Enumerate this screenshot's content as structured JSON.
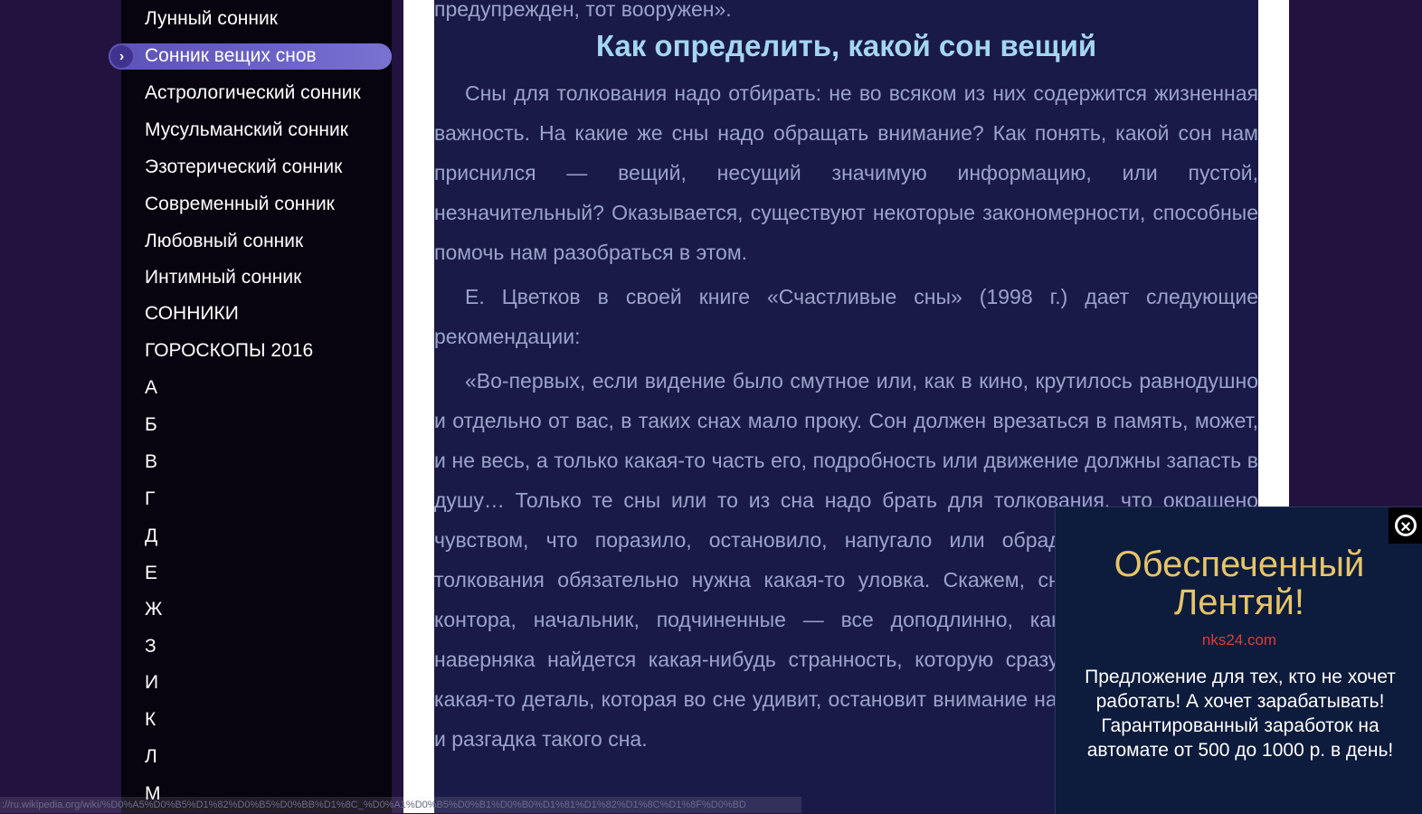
{
  "sidebar": {
    "items": [
      {
        "label": "Лунный сонник"
      },
      {
        "label": "Сонник вещих снов",
        "active": true
      },
      {
        "label": "Астрологический сонник"
      },
      {
        "label": "Мусульманский сонник"
      },
      {
        "label": "Эзотерический сонник"
      },
      {
        "label": "Современный сонник"
      },
      {
        "label": "Любовный сонник"
      },
      {
        "label": "Интимный сонник"
      },
      {
        "label": "СОННИКИ"
      },
      {
        "label": "ГОРОСКОПЫ 2016"
      },
      {
        "label": "А"
      },
      {
        "label": "Б"
      },
      {
        "label": "В"
      },
      {
        "label": "Г"
      },
      {
        "label": "Д"
      },
      {
        "label": "Е"
      },
      {
        "label": "Ж"
      },
      {
        "label": "З"
      },
      {
        "label": "И"
      },
      {
        "label": "К"
      },
      {
        "label": "Л"
      },
      {
        "label": "М"
      }
    ],
    "active_icon": "chevron-right-icon",
    "active_glyph": "›"
  },
  "article": {
    "top_fragment": "предупрежден, тот вооружен».",
    "heading": "Как определить, какой сон вещий",
    "paragraphs": [
      "Сны для толкования надо отбирать: не во всяком из них содержится жизненная важность. На какие же сны надо обращать внимание? Как понять, какой сон нам приснился — вещий, несущий значимую информацию, или пустой, незначительный? Оказывается, существуют некоторые закономерности, способные помочь нам разобраться в этом.",
      "Е. Цветков в своей книге «Счастливые сны» (1998 г.) дает следующие рекомендации:",
      "«Во-первых, если видение было смутное или, как в кино, крутилось равнодушно и отдельно от вас, в таких снах мало проку. Сон должен врезаться в память, может, и не весь, а только какая-то часть его, подробность или движение должны запасть в душу… Только те сны или то из сна надо брать для толкования, что окрашено чувством, что поразило, остановило, напугало или обрадовало… Вене для толкования обязательно нужна какая-то уловка. Скажем, снится чиновнику его контора, начальник, подчиненные — все доподлинно, как в жизни. Однако наверняка найдется какая-нибудь странность, которую сразу и не припомнишь, какая-то деталь, которая во сне удивит, остановит внимание на себе. В этой детали и разгадка такого сна."
    ]
  },
  "statusbar": {
    "url": "://ru.wikipedia.org/wiki/%D0%A5%D0%B5%D1%82%D0%B5%D0%BB%D1%8C_%D0%A1%D0%B5%D0%B1%D0%B0%D1%81%D1%82%D1%8C%D1%8F%D0%BD"
  },
  "popup": {
    "close_icon": "close-circle-icon",
    "close_glyph": "×",
    "title": "Обеспеченный Лентяй!",
    "url": "nks24.com",
    "text": "Предложение для тех, кто не хочет работать! А хочет зарабатывать! Гарантированный заработок на автомате от 500 до 1000 р. в день!",
    "colors": {
      "title": "#e6c468",
      "url": "#e23a3a",
      "background": "#0d1b3c"
    }
  },
  "colors": {
    "page_background": "#22123f",
    "sidebar_background": "#07030f",
    "content_background": "#1a1a48",
    "body_text": "#9aa3c9",
    "heading": "#a4d6f0",
    "active_item": "#6b63c7"
  }
}
